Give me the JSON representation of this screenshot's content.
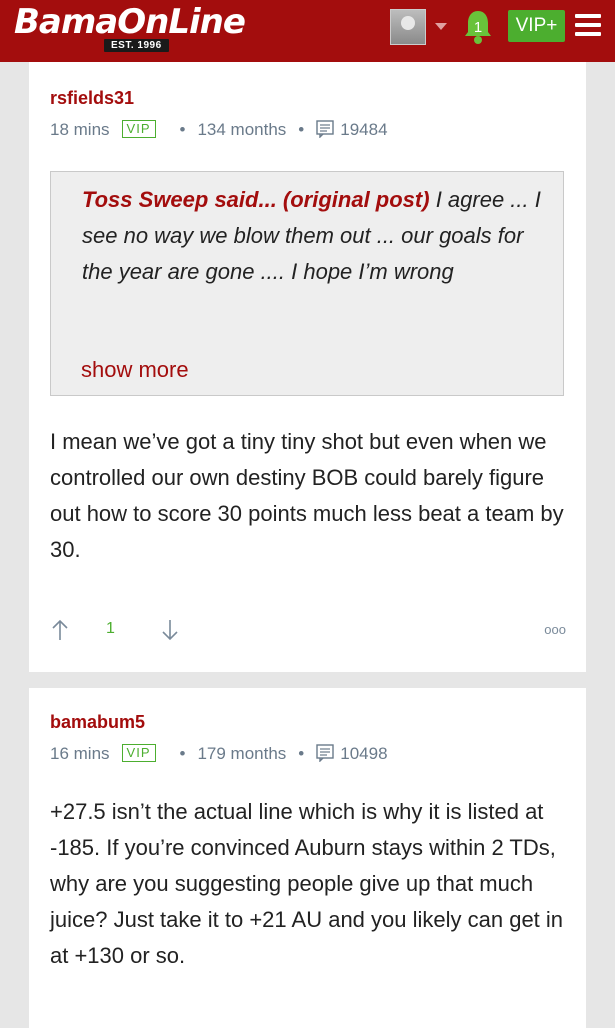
{
  "header": {
    "logo": "BamaOnLine",
    "est": "EST. 1996",
    "notification_count": "1",
    "vip_label": "VIP+"
  },
  "posts": [
    {
      "author": "rsfields31",
      "time": "18 mins",
      "badge": "VIP",
      "tenure": "134 months",
      "post_count": "19484",
      "quote": {
        "attribution": "Toss Sweep said... (original post)",
        "attribution_link": "original post",
        "text": "I agree ... I see no way we blow them out ... our goals for the year are gone .... I hope I’m wrong",
        "show_more": "show more"
      },
      "body": "I mean we’ve got a tiny tiny shot but even when we controlled our own destiny BOB could barely figure out how to score 30 points much less beat a team by 30.",
      "votes": "1",
      "more": "ooo"
    },
    {
      "author": "bamabum5",
      "time": "16 mins",
      "badge": "VIP",
      "tenure": "179 months",
      "post_count": "10498",
      "body": "+27.5 isn’t the actual line which is why it is listed at -185. If you’re convinced Auburn stays within 2 TDs, why are you suggesting people give up that much juice? Just take it to +21 AU and you likely can get in at +130 or so."
    }
  ],
  "colors": {
    "brand": "#a30d0d",
    "vip_green": "#4cae2f",
    "meta_gray": "#6a7a8a"
  },
  "icons": [
    "bell-icon",
    "menu-icon",
    "comment-count-icon",
    "upvote-arrow-icon",
    "downvote-arrow-icon",
    "more-options-icon"
  ]
}
